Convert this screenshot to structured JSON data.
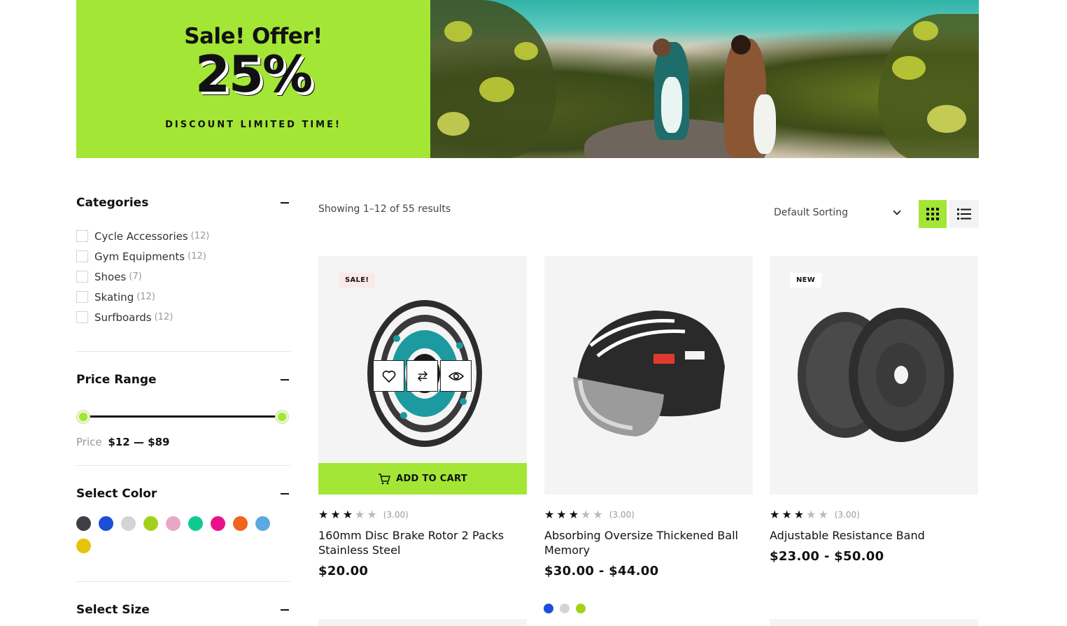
{
  "banner": {
    "headline": "Sale! Offer!",
    "percent": "25%",
    "subtitle": "DISCOUNT LIMITED TIME!"
  },
  "sidebar": {
    "categories": {
      "title": "Categories",
      "items": [
        {
          "label": "Cycle Accessories",
          "count": "(12)"
        },
        {
          "label": "Gym Equipments",
          "count": "(12)"
        },
        {
          "label": "Shoes",
          "count": "(7)"
        },
        {
          "label": "Skating",
          "count": "(12)"
        },
        {
          "label": "Surfboards",
          "count": "(12)"
        }
      ]
    },
    "price_range": {
      "title": "Price Range",
      "label": "Price",
      "value": "$12 — $89",
      "min": 12,
      "max": 89
    },
    "color": {
      "title": "Select Color",
      "swatches": [
        "#3f3f46",
        "#1d4ed8",
        "#d4d4d4",
        "#a3d11a",
        "#e8a7c8",
        "#10c98f",
        "#ec0f8a",
        "#f0641e",
        "#5aa9e0",
        "#e6c40c"
      ]
    },
    "size": {
      "title": "Select Size"
    }
  },
  "toolbar": {
    "result_count": "Showing 1–12 of 55 results",
    "sort_selected": "Default Sorting",
    "accent": "#a3e635"
  },
  "products": [
    {
      "badge": "SALE!",
      "title": "160mm Disc Brake Rotor 2 Packs Stainless Steel",
      "price": "$20.00",
      "rating": "(3.00)",
      "stars": 3,
      "add_to_cart": "ADD TO CART",
      "image_icon": "disc-brake-rotor"
    },
    {
      "badge": "",
      "title": "Absorbing Oversize Thickened Ball Memory",
      "price": "$30.00 - $44.00",
      "rating": "(3.00)",
      "stars": 3,
      "image_icon": "cycling-helmet",
      "colors": [
        "#1d4ed8",
        "#d4d4d4",
        "#a3d11a"
      ]
    },
    {
      "badge": "NEW",
      "title": "Adjustable Resistance Band",
      "price": "$23.00 - $50.00",
      "rating": "(3.00)",
      "stars": 3,
      "image_icon": "barbell-plates"
    }
  ]
}
